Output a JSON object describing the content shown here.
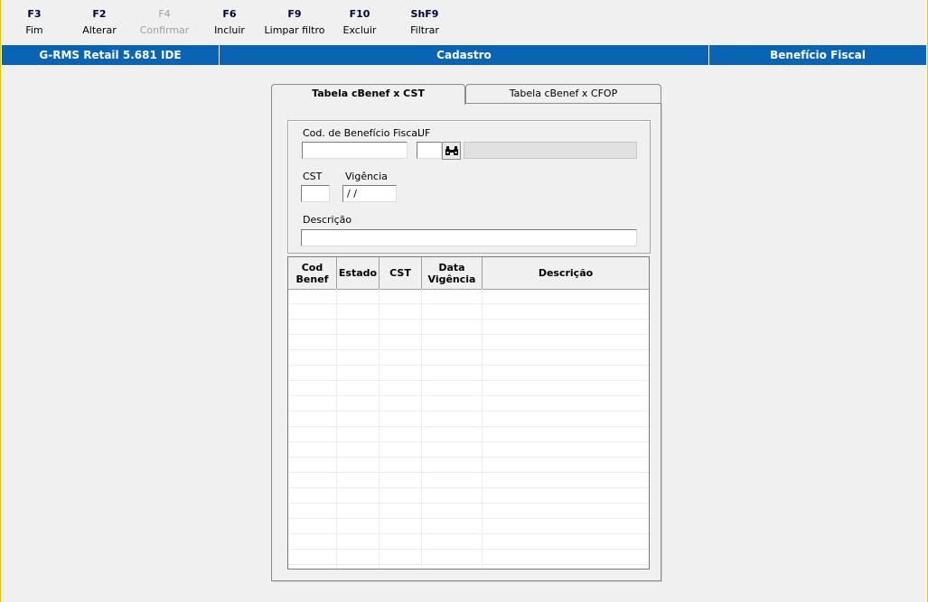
{
  "toolbar": {
    "buttons": [
      {
        "key": "F3",
        "label": "Fim",
        "enabled": true
      },
      {
        "key": "F2",
        "label": "Alterar",
        "enabled": true
      },
      {
        "key": "F4",
        "label": "Confirmar",
        "enabled": false
      },
      {
        "key": "F6",
        "label": "Incluir",
        "enabled": true
      },
      {
        "key": "F9",
        "label": "Limpar filtro",
        "enabled": true
      },
      {
        "key": "F10",
        "label": "Excluir",
        "enabled": true
      },
      {
        "key": "ShF9",
        "label": "Filtrar",
        "enabled": true
      }
    ]
  },
  "titlebar": {
    "app": "G-RMS Retail 5.681 IDE",
    "section": "Cadastro",
    "screen": "Benefício Fiscal"
  },
  "tabs": [
    {
      "label": "Tabela cBenef x CST",
      "active": true
    },
    {
      "label": "Tabela cBenef x CFOP",
      "active": false
    }
  ],
  "form": {
    "cod_label": "Cod. de Benefício Fiscal",
    "cod_value": "",
    "uf_label": "UF",
    "uf_value": "",
    "uf_name_value": "",
    "cst_label": "CST",
    "cst_value": "",
    "vigencia_label": "Vigência",
    "vigencia_value": "/ /",
    "descricao_label": "Descrição",
    "descricao_value": ""
  },
  "grid": {
    "columns": [
      "Cod\nBenef",
      "Estado",
      "CST",
      "Data\nVigência",
      "Descrição"
    ],
    "rows": []
  },
  "colors": {
    "titlebar": "#0a64b4",
    "toolbar_key": "#00003c"
  },
  "icons": {
    "lookup": "binoculars-icon"
  }
}
